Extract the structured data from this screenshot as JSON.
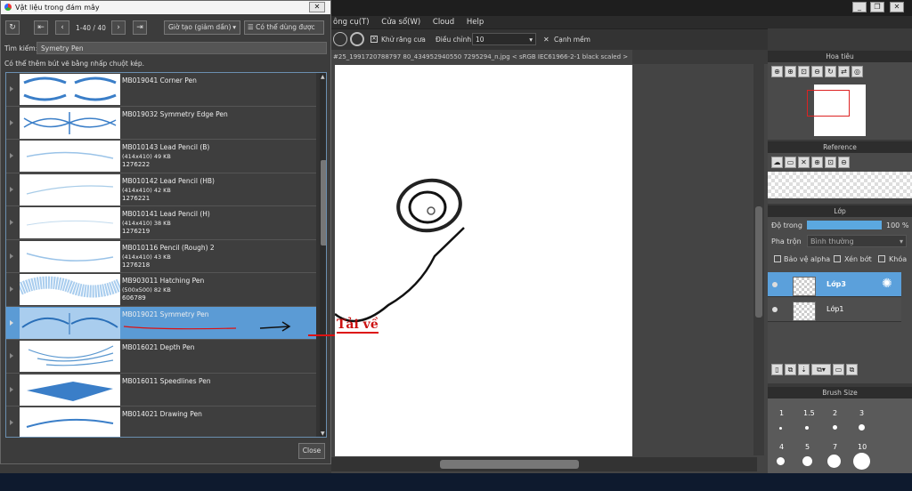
{
  "app": {
    "menu": [
      "ông cụ(T)",
      "Cửa sổ(W)",
      "Cloud",
      "Help"
    ],
    "toolbar": {
      "antialias_label": "Khử răng cưa",
      "adjust_label": "Điều chỉnh",
      "adjust_value": "10",
      "smooth_label": "Cạnh mềm"
    },
    "doc_tab": "#25_1991720788797 80_434952940550 7295294_n.jpg < sRGB IEC61966-2-1 black scaled >"
  },
  "panels": {
    "navigator": {
      "title": "Hoa tiêu"
    },
    "reference": {
      "title": "Reference"
    },
    "layer": {
      "title": "Lớp",
      "opacity_label": "Độ trong",
      "opacity_value": "100 %",
      "blend_label": "Pha trộn",
      "blend_value": "Bình thường",
      "alpha_label": "Bảo vệ alpha",
      "clip_label": "Xén bớt",
      "lock_label": "Khóa",
      "layers": [
        {
          "name": "Lớp3",
          "selected": true
        },
        {
          "name": "Lớp1",
          "selected": false
        }
      ]
    },
    "brush_size": {
      "title": "Brush Size",
      "sizes": [
        "1",
        "1.5",
        "2",
        "3",
        "4",
        "5",
        "7",
        "10"
      ]
    }
  },
  "dialog": {
    "title": "Vật liệu trong đám mây",
    "pager": "1-40 / 40",
    "sort_value": "Giờ tạo (giảm dần)",
    "usable_label": "Có thể dùng được",
    "search_label": "Tìm kiếm:",
    "search_value": "Symetry Pen",
    "hint": "Có thể thêm bút vẽ bằng nhấp chuột kép.",
    "close_label": "Close",
    "annotation": "Tải về",
    "items": [
      {
        "name": "MB019041 Corner Pen",
        "size": "",
        "kb": "",
        "id": ""
      },
      {
        "name": "MB019032 Symmetry Edge Pen",
        "size": "",
        "kb": "",
        "id": ""
      },
      {
        "name": "MB010143 Lead Pencil (B)",
        "size": "(414x410)",
        "kb": "49 KB",
        "id": "1276222"
      },
      {
        "name": "MB010142 Lead Pencil (HB)",
        "size": "(414x410)",
        "kb": "42 KB",
        "id": "1276221"
      },
      {
        "name": "MB010141 Lead Pencil (H)",
        "size": "(414x410)",
        "kb": "38 KB",
        "id": "1276219"
      },
      {
        "name": "MB010116 Pencil (Rough) 2",
        "size": "(414x410)",
        "kb": "43 KB",
        "id": "1276218"
      },
      {
        "name": "MB903011 Hatching Pen",
        "size": "(500x500)",
        "kb": "82 KB",
        "id": "606789"
      },
      {
        "name": "MB019021 Symmetry Pen",
        "size": "",
        "kb": "",
        "id": ""
      },
      {
        "name": "MB016021 Depth Pen",
        "size": "",
        "kb": "",
        "id": ""
      },
      {
        "name": "MB016011 Speedlines Pen",
        "size": "",
        "kb": "",
        "id": ""
      },
      {
        "name": "MB014021 Drawing Pen",
        "size": "",
        "kb": "",
        "id": ""
      }
    ]
  }
}
